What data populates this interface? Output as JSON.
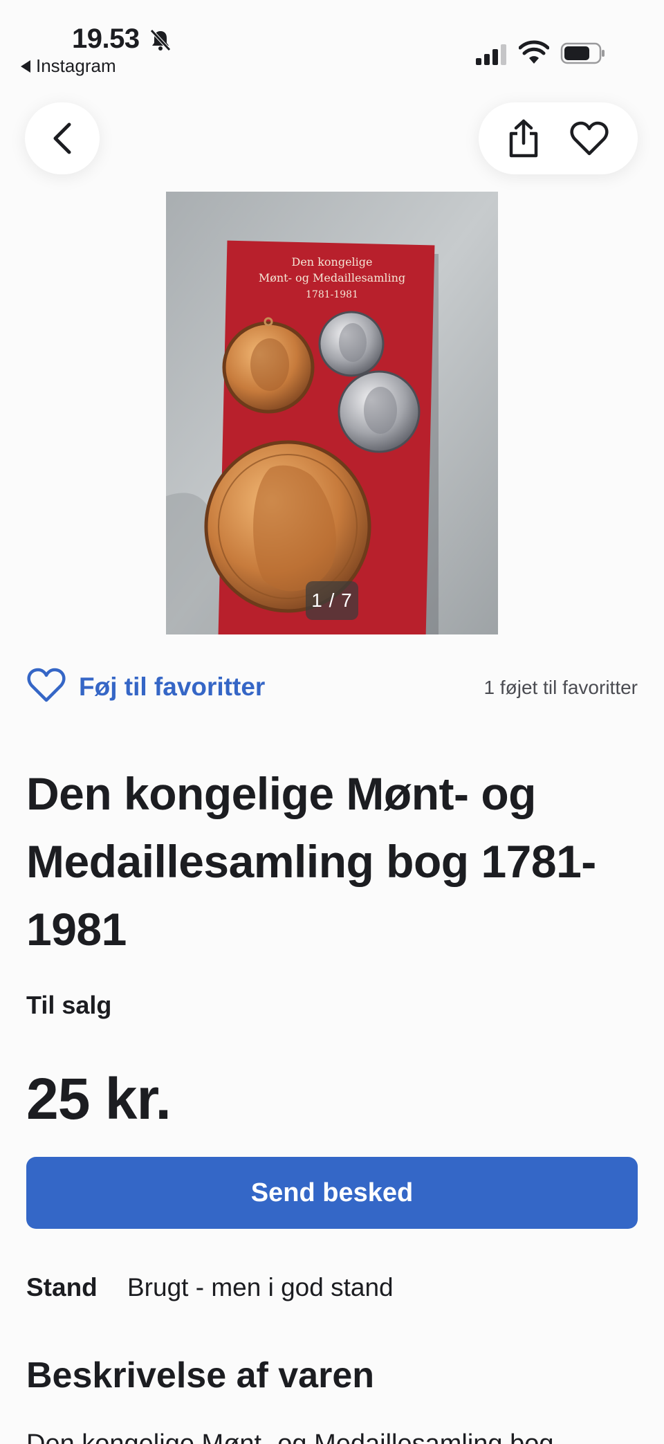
{
  "status_bar": {
    "time": "19.53",
    "back_app": "Instagram"
  },
  "icons": {
    "bell": "bell-slash-icon",
    "signal": "cellular-signal-icon",
    "wifi": "wifi-icon",
    "battery": "battery-icon",
    "back": "chevron-left-icon",
    "share": "share-icon",
    "favorite": "heart-icon"
  },
  "image": {
    "counter": "1 / 7",
    "cover_lines": [
      "Den kongelige",
      "Mønt- og Medaillesamling",
      "1781-1981"
    ]
  },
  "favorites": {
    "label": "Føj til favoritter",
    "count": "1 føjet til favoritter"
  },
  "listing": {
    "title": "Den kongelige Mønt- og Medaillesamling bog 1781-1981",
    "sale_status": "Til salg",
    "price": "25 kr."
  },
  "actions": {
    "send_message": "Send besked"
  },
  "details": {
    "condition_label": "Stand",
    "condition_value": "Brugt - men i god stand"
  },
  "description": {
    "heading": "Beskrivelse af varen",
    "text": "Den kongelige Mønt- og Medaillesamling bog"
  },
  "colors": {
    "accent": "#3467c7",
    "background": "#fbfbfb",
    "book_cover": "#b8202c"
  }
}
